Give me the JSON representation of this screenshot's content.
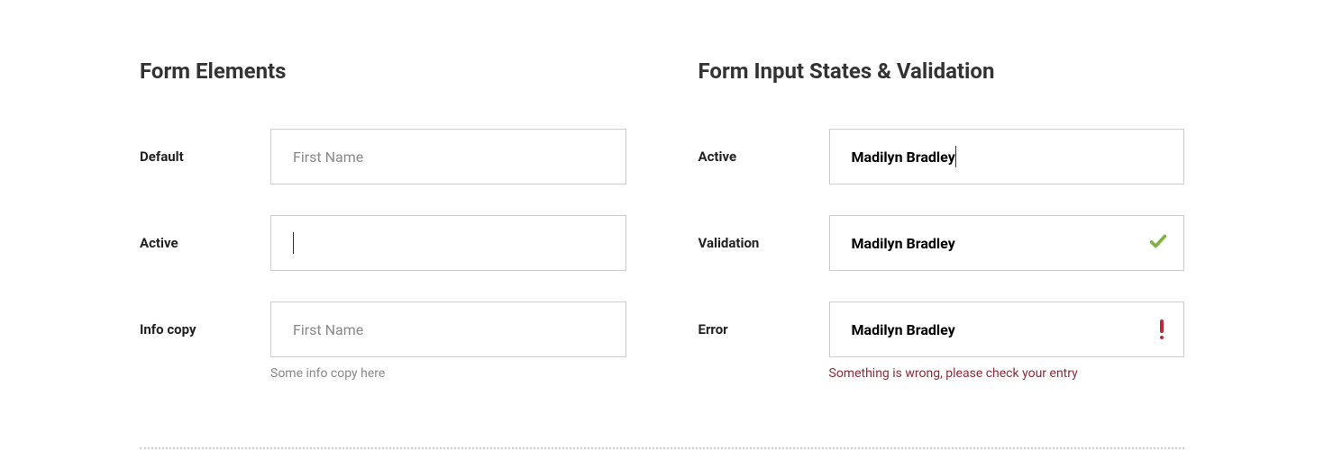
{
  "left": {
    "title": "Form Elements",
    "rows": {
      "default": {
        "label": "Default",
        "placeholder": "First Name"
      },
      "active": {
        "label": "Active",
        "value": ""
      },
      "info": {
        "label": "Info copy",
        "placeholder": "First Name",
        "helper": "Some info copy here"
      }
    }
  },
  "right": {
    "title": "Form Input States & Validation",
    "rows": {
      "active": {
        "label": "Active",
        "value": "Madilyn Bradley"
      },
      "validation": {
        "label": "Validation",
        "value": "Madilyn Bradley"
      },
      "error": {
        "label": "Error",
        "value": "Madilyn Bradley",
        "message": "Something is wrong, please check your entry"
      }
    }
  }
}
